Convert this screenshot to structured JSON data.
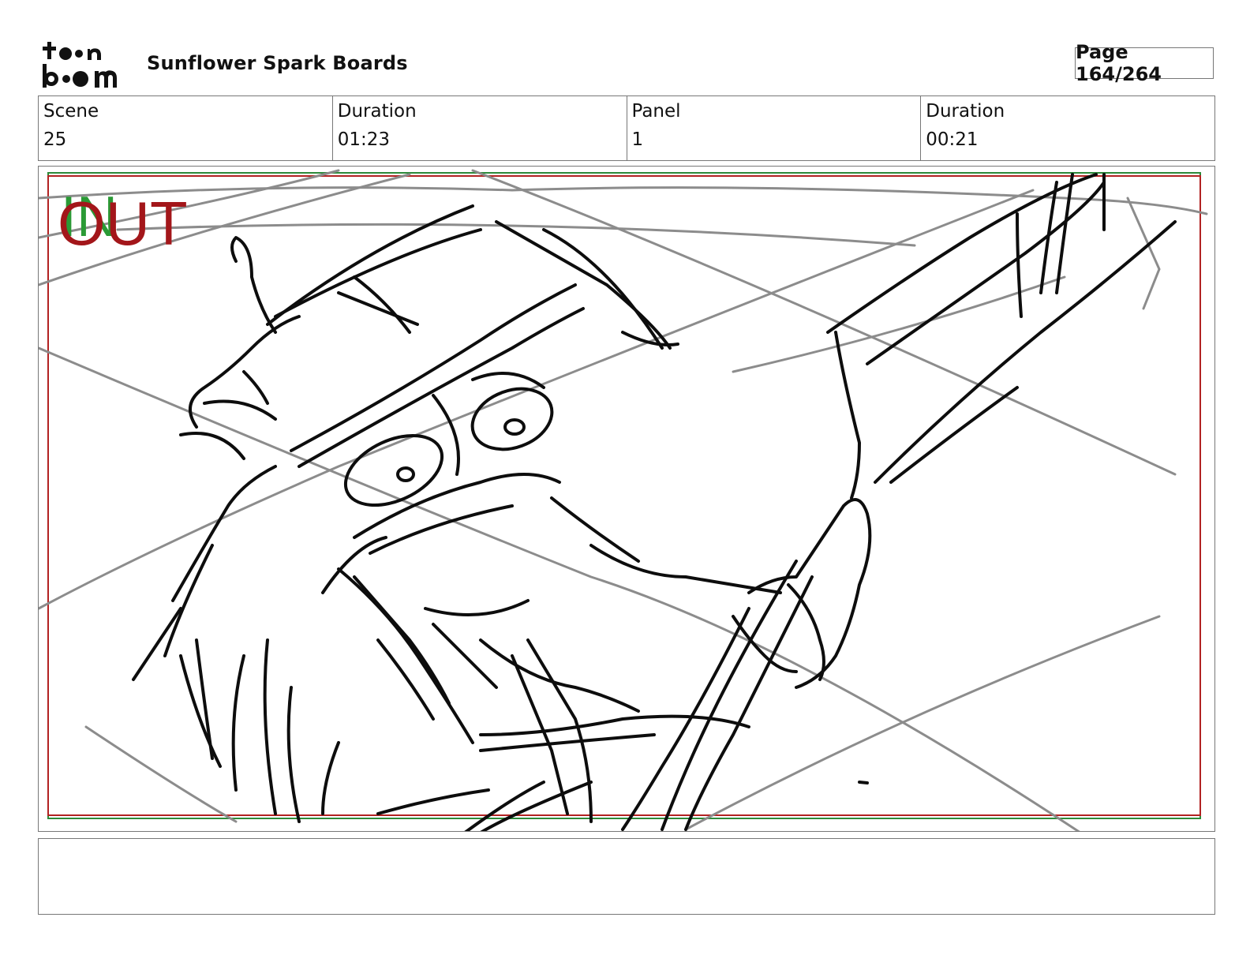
{
  "header": {
    "logo_line1": "to•n",
    "logo_line2": "b••m",
    "project_title": "Sunflower Spark Boards",
    "page_label": "Page 164/264"
  },
  "info": [
    {
      "label": "Scene",
      "value": "25"
    },
    {
      "label": "Duration",
      "value": "01:23"
    },
    {
      "label": "Panel",
      "value": "1"
    },
    {
      "label": "Duration",
      "value": "00:21"
    }
  ],
  "panel": {
    "in_marker": "IN",
    "out_marker": "OUT",
    "in_color": "#2a9a35",
    "out_color": "#a3161a"
  },
  "notes": {
    "text": ""
  }
}
